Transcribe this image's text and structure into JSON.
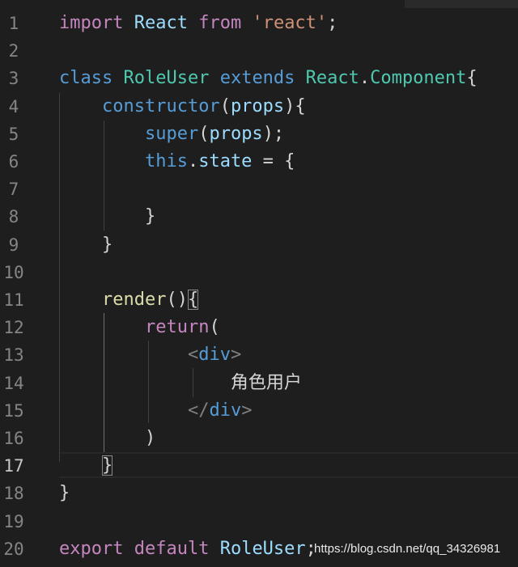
{
  "editor": {
    "active_line": 17,
    "lines": [
      {
        "n": "1",
        "tokens": [
          {
            "t": "import",
            "c": "kw-purple"
          },
          {
            "t": " "
          },
          {
            "t": "React",
            "c": "var"
          },
          {
            "t": " "
          },
          {
            "t": "from",
            "c": "kw-purple"
          },
          {
            "t": " "
          },
          {
            "t": "'react'",
            "c": "str"
          },
          {
            "t": ";"
          }
        ]
      },
      {
        "n": "2",
        "tokens": []
      },
      {
        "n": "3",
        "tokens": [
          {
            "t": "class",
            "c": "kw-blue"
          },
          {
            "t": " "
          },
          {
            "t": "RoleUser",
            "c": "type"
          },
          {
            "t": " "
          },
          {
            "t": "extends",
            "c": "kw-blue"
          },
          {
            "t": " "
          },
          {
            "t": "React",
            "c": "type"
          },
          {
            "t": "."
          },
          {
            "t": "Component",
            "c": "type"
          },
          {
            "t": "{"
          }
        ]
      },
      {
        "n": "4",
        "tokens": [
          {
            "t": "    "
          },
          {
            "t": "constructor",
            "c": "kw-blue"
          },
          {
            "t": "("
          },
          {
            "t": "props",
            "c": "var"
          },
          {
            "t": "){"
          }
        ]
      },
      {
        "n": "5",
        "tokens": [
          {
            "t": "        "
          },
          {
            "t": "super",
            "c": "kw-blue"
          },
          {
            "t": "("
          },
          {
            "t": "props",
            "c": "var"
          },
          {
            "t": ");"
          }
        ]
      },
      {
        "n": "6",
        "tokens": [
          {
            "t": "        "
          },
          {
            "t": "this",
            "c": "kw-blue"
          },
          {
            "t": "."
          },
          {
            "t": "state",
            "c": "var"
          },
          {
            "t": " = {"
          }
        ]
      },
      {
        "n": "7",
        "tokens": []
      },
      {
        "n": "8",
        "tokens": [
          {
            "t": "        }"
          }
        ]
      },
      {
        "n": "9",
        "tokens": [
          {
            "t": "    }"
          }
        ]
      },
      {
        "n": "10",
        "tokens": []
      },
      {
        "n": "11",
        "tokens": [
          {
            "t": "    "
          },
          {
            "t": "render",
            "c": "fn"
          },
          {
            "t": "()"
          },
          {
            "t": "{",
            "c": "bm"
          }
        ]
      },
      {
        "n": "12",
        "tokens": [
          {
            "t": "        "
          },
          {
            "t": "return",
            "c": "kw-purple"
          },
          {
            "t": "("
          }
        ]
      },
      {
        "n": "13",
        "tokens": [
          {
            "t": "            "
          },
          {
            "t": "<",
            "c": "tagpunct"
          },
          {
            "t": "div",
            "c": "tag"
          },
          {
            "t": ">",
            "c": "tagpunct"
          }
        ]
      },
      {
        "n": "14",
        "tokens": [
          {
            "t": "                "
          },
          {
            "t": "角色用户",
            "c": "cjk"
          }
        ]
      },
      {
        "n": "15",
        "tokens": [
          {
            "t": "            "
          },
          {
            "t": "</",
            "c": "tagpunct"
          },
          {
            "t": "div",
            "c": "tag"
          },
          {
            "t": ">",
            "c": "tagpunct"
          }
        ]
      },
      {
        "n": "16",
        "tokens": [
          {
            "t": "        )"
          }
        ]
      },
      {
        "n": "17",
        "tokens": [
          {
            "t": "    "
          },
          {
            "t": "}",
            "c": "bm"
          }
        ]
      },
      {
        "n": "18",
        "tokens": [
          {
            "t": "}"
          }
        ]
      },
      {
        "n": "19",
        "tokens": []
      },
      {
        "n": "20",
        "tokens": [
          {
            "t": "export",
            "c": "kw-purple"
          },
          {
            "t": " "
          },
          {
            "t": "default",
            "c": "kw-purple"
          },
          {
            "t": " "
          },
          {
            "t": "RoleUser",
            "c": "var"
          },
          {
            "t": ";"
          }
        ]
      }
    ]
  },
  "watermark": {
    "text": "https://blog.csdn.net/qq_34326981"
  }
}
